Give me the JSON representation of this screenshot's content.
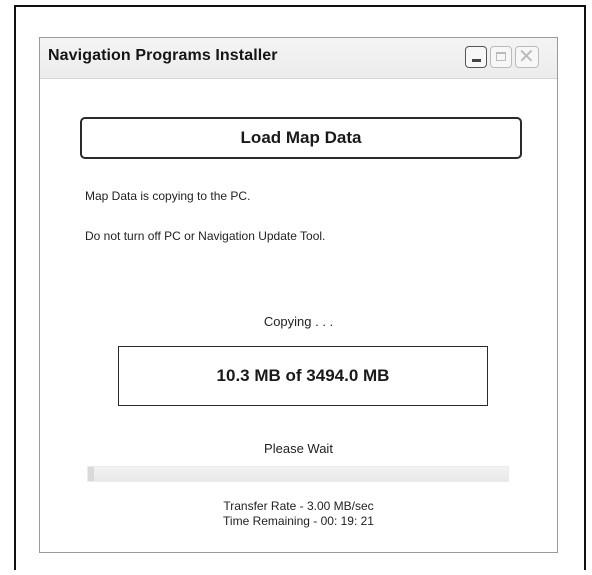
{
  "window": {
    "title": "Navigation Programs Installer"
  },
  "load_button": {
    "label": "Load Map Data"
  },
  "messages": {
    "line1": "Map Data is copying to the PC.",
    "line2": "Do not turn off PC or Navigation Update Tool."
  },
  "status": {
    "copying": "Copying . . .",
    "size": "10.3 MB of 3494.0 MB",
    "please_wait": "Please Wait",
    "progress_fraction": 0.003,
    "transfer_rate": "Transfer Rate - 3.00 MB/sec",
    "time_remaining": "Time Remaining - 00: 19: 21"
  },
  "icons": {
    "minimize": "minimize-icon",
    "maximize": "maximize-icon",
    "close": "close-icon"
  }
}
